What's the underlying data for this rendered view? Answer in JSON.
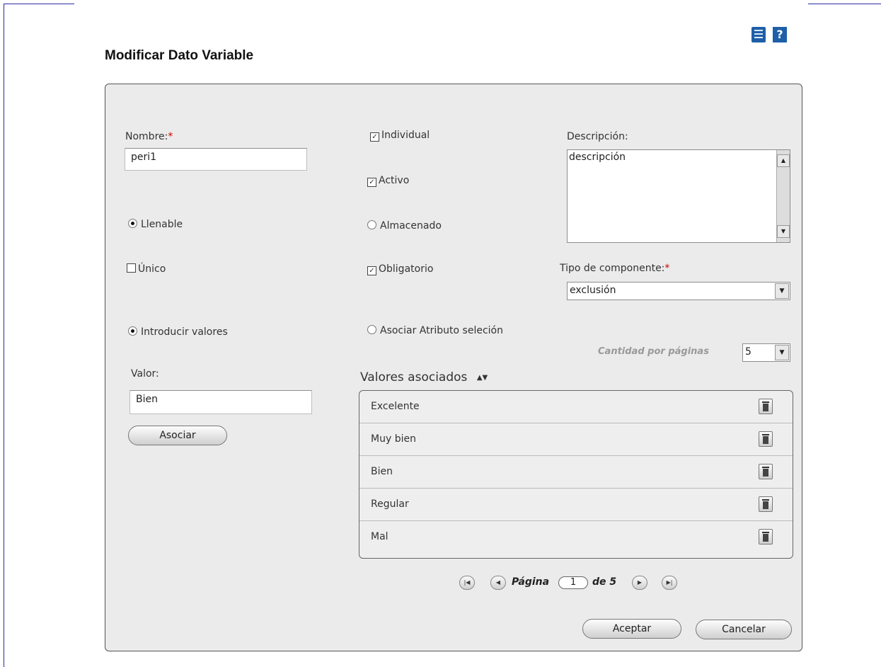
{
  "page": {
    "title": "Modificar  Dato Variable"
  },
  "top_icons": {
    "list": "list-icon",
    "help": "help-icon",
    "help_glyph": "?"
  },
  "form": {
    "nombre_label": "Nombre:",
    "nombre_required": "*",
    "nombre_value": "peri1",
    "individual_label": "Individual",
    "individual_checked": true,
    "activo_label": "Activo",
    "activo_checked": true,
    "llenable_label": "Llenable",
    "almacenado_label": "Almacenado",
    "unico_label": "Único",
    "unico_checked": false,
    "obligatorio_label": "Obligatorio",
    "obligatorio_checked": true,
    "descripcion_label": "Descripción:",
    "descripcion_value": "descripción",
    "tipo_label": "Tipo de componente:",
    "tipo_required": "*",
    "tipo_value": "exclusión",
    "introducir_label": "Introducir valores",
    "asociar_attr_label": "Asociar Atributo seleción",
    "cantidad_label": "Cantidad por páginas",
    "cantidad_value": "5",
    "valor_label": "Valor:",
    "valor_value": "Bien",
    "asociar_button": "Asociar"
  },
  "valores": {
    "title": "Valores asociados",
    "sort_glyph": "▲▼",
    "items": [
      "Excelente",
      "Muy bien",
      "Bien",
      "Regular",
      "Mal"
    ]
  },
  "pagination": {
    "pagina_label": "Página",
    "current": "1",
    "de_label": "de 5"
  },
  "actions": {
    "aceptar": "Aceptar",
    "cancelar": "Cancelar"
  },
  "colors": {
    "accent": "#1e5fa8",
    "required": "#cc0000",
    "panel_bg": "#ebebeb"
  }
}
